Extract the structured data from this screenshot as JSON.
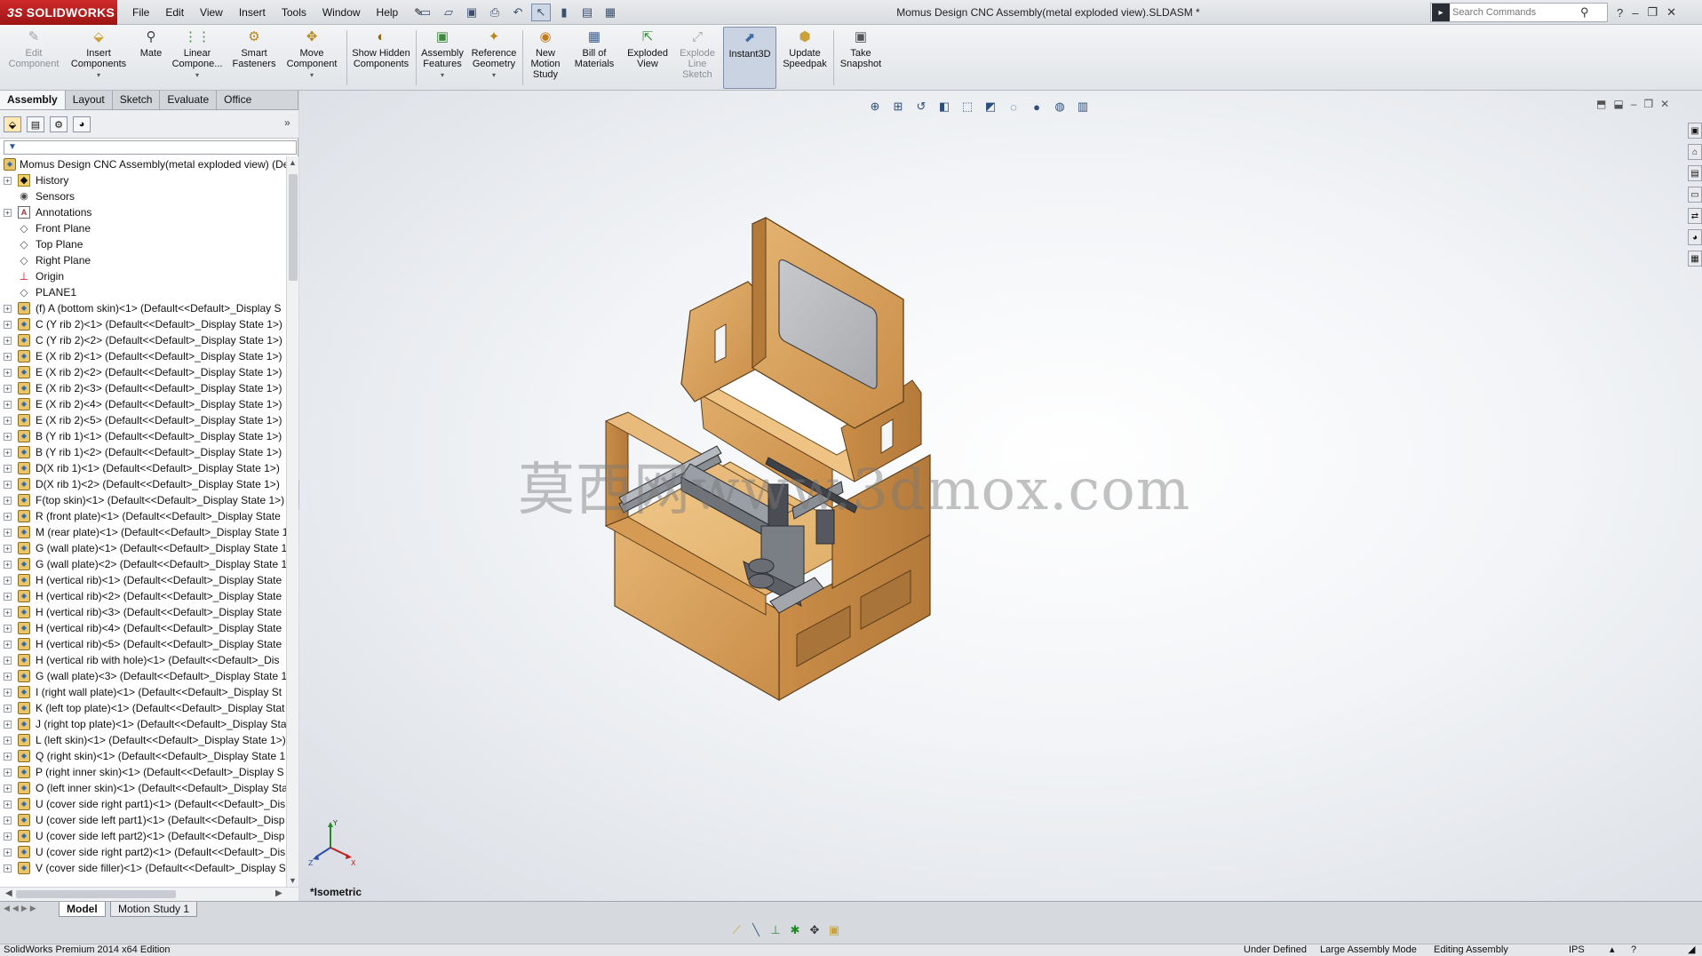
{
  "titlebar": {
    "brand": "SOLIDWORKS",
    "brand_mark": "3S",
    "document_title": "Momus Design CNC Assembly(metal exploded view).SLDASM *",
    "search_placeholder": "Search Commands",
    "menus": [
      "File",
      "Edit",
      "View",
      "Insert",
      "Tools",
      "Window",
      "Help"
    ]
  },
  "command_manager": {
    "buttons": [
      {
        "label": "Edit Component",
        "icon": "edit-component-icon",
        "enabled": false
      },
      {
        "label": "Insert Components",
        "icon": "insert-components-icon",
        "enabled": true
      },
      {
        "label": "Mate",
        "icon": "mate-icon",
        "enabled": true
      },
      {
        "label": "Linear Compone...",
        "icon": "linear-pattern-icon",
        "enabled": true
      },
      {
        "label": "Smart Fasteners",
        "icon": "smart-fasteners-icon",
        "enabled": true
      },
      {
        "label": "Move Component",
        "icon": "move-component-icon",
        "enabled": true
      },
      {
        "label": "Show Hidden Components",
        "icon": "show-hidden-icon",
        "enabled": true
      },
      {
        "label": "Assembly Features",
        "icon": "assembly-features-icon",
        "enabled": true
      },
      {
        "label": "Reference Geometry",
        "icon": "reference-geometry-icon",
        "enabled": true
      },
      {
        "label": "New Motion Study",
        "icon": "motion-study-icon",
        "enabled": true
      },
      {
        "label": "Bill of Materials",
        "icon": "bom-icon",
        "enabled": true
      },
      {
        "label": "Exploded View",
        "icon": "exploded-view-icon",
        "enabled": true
      },
      {
        "label": "Explode Line Sketch",
        "icon": "explode-line-icon",
        "enabled": false
      },
      {
        "label": "Instant3D",
        "icon": "instant3d-icon",
        "enabled": true,
        "active": true
      },
      {
        "label": "Update Speedpak",
        "icon": "speedpak-icon",
        "enabled": true
      },
      {
        "label": "Take Snapshot",
        "icon": "snapshot-icon",
        "enabled": true
      }
    ],
    "tabs": [
      "Assembly",
      "Layout",
      "Sketch",
      "Evaluate",
      "Office Products"
    ],
    "active_tab": "Assembly"
  },
  "feature_tree": {
    "root": "Momus Design CNC Assembly(metal exploded view)  (De",
    "fixed_items": [
      {
        "label": "History",
        "icon": "folder",
        "expandable": true
      },
      {
        "label": "Sensors",
        "icon": "sensor",
        "expandable": false
      },
      {
        "label": "Annotations",
        "icon": "annot",
        "expandable": true
      },
      {
        "label": "Front Plane",
        "icon": "plane",
        "expandable": false
      },
      {
        "label": "Top Plane",
        "icon": "plane",
        "expandable": false
      },
      {
        "label": "Right Plane",
        "icon": "plane",
        "expandable": false
      },
      {
        "label": "Origin",
        "icon": "origin",
        "expandable": false
      },
      {
        "label": "PLANE1",
        "icon": "plane",
        "expandable": false
      }
    ],
    "components": [
      "(f) A (bottom skin)<1> (Default<<Default>_Display S",
      "C (Y rib 2)<1> (Default<<Default>_Display State 1>)",
      "C (Y rib 2)<2> (Default<<Default>_Display State 1>)",
      "E (X rib 2)<1> (Default<<Default>_Display State 1>)",
      "E (X rib 2)<2> (Default<<Default>_Display State 1>)",
      "E (X rib 2)<3> (Default<<Default>_Display State 1>)",
      "E (X rib 2)<4> (Default<<Default>_Display State 1>)",
      "E (X rib 2)<5> (Default<<Default>_Display State 1>)",
      "B (Y rib 1)<1> (Default<<Default>_Display State 1>)",
      "B (Y rib 1)<2> (Default<<Default>_Display State 1>)",
      "D(X rib 1)<1> (Default<<Default>_Display State 1>)",
      "D(X rib 1)<2> (Default<<Default>_Display State 1>)",
      "F(top skin)<1> (Default<<Default>_Display State 1>)",
      "R (front plate)<1> (Default<<Default>_Display State",
      "M (rear plate)<1> (Default<<Default>_Display State 1",
      "G (wall plate)<1> (Default<<Default>_Display State 1",
      "G (wall plate)<2> (Default<<Default>_Display State 1",
      "H (vertical rib)<1> (Default<<Default>_Display State",
      "H (vertical rib)<2> (Default<<Default>_Display State",
      "H (vertical rib)<3> (Default<<Default>_Display State",
      "H (vertical rib)<4> (Default<<Default>_Display State",
      "H (vertical rib)<5> (Default<<Default>_Display State",
      "H (vertical rib with hole)<1> (Default<<Default>_Dis",
      "G (wall plate)<3> (Default<<Default>_Display State 1",
      "I (right wall plate)<1> (Default<<Default>_Display St",
      "K (left top plate)<1> (Default<<Default>_Display Stat",
      "J (right top plate)<1> (Default<<Default>_Display Sta",
      "L (left skin)<1> (Default<<Default>_Display State 1>)",
      "Q (right skin)<1> (Default<<Default>_Display State 1",
      "P (right inner skin)<1> (Default<<Default>_Display S",
      "O (left inner skin)<1> (Default<<Default>_Display Sta",
      "U (cover side right part1)<1> (Default<<Default>_Dis",
      "U (cover side left part1)<1> (Default<<Default>_Disp",
      "U (cover side left part2)<1> (Default<<Default>_Disp",
      "U (cover side right part2)<1> (Default<<Default>_Dis",
      "V (cover side filler)<1> (Default<<Default>_Display S"
    ]
  },
  "viewport": {
    "view_name": "*Isometric",
    "watermark": "莫西网www.3dmox.com",
    "triad_axes": [
      "X",
      "Y",
      "Z"
    ]
  },
  "bottom_tabs": [
    "Model",
    "Motion Study 1"
  ],
  "active_bottom_tab": "Model",
  "statusbar": {
    "edition": "SolidWorks Premium 2014 x64 Edition",
    "state": "Under Defined",
    "mode": "Large Assembly Mode",
    "editing": "Editing Assembly",
    "units": "IPS"
  },
  "colors": {
    "brand_red": "#c01f1f",
    "wood": "#d8a35f",
    "wood_dark": "#a8733a",
    "metal": "#8a8e95"
  }
}
